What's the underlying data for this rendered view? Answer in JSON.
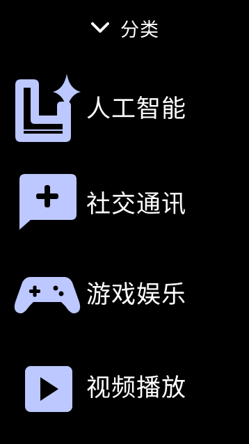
{
  "header": {
    "title": "分类",
    "icon": "chevron-down-icon"
  },
  "categories": [
    {
      "label": "人工智能",
      "icon": "ai-sparkle-icon"
    },
    {
      "label": "社交通讯",
      "icon": "chat-plus-icon"
    },
    {
      "label": "游戏娱乐",
      "icon": "gamepad-icon"
    },
    {
      "label": "视频播放",
      "icon": "play-icon"
    }
  ],
  "colors": {
    "background": "#000000",
    "icon": "#bcc8ff",
    "text": "#ffffff"
  }
}
